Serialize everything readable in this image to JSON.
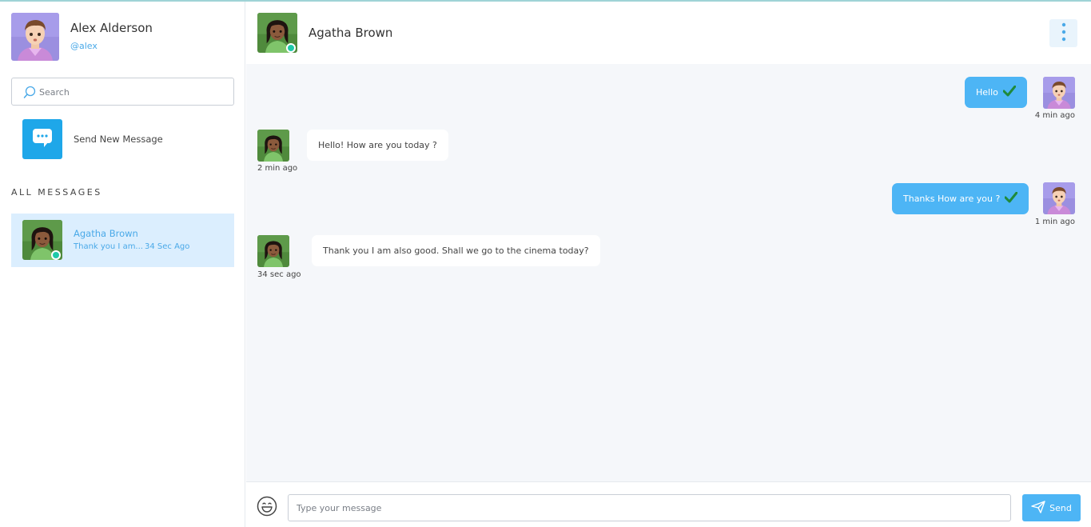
{
  "profile": {
    "name": "Alex Alderson",
    "handle": "@alex"
  },
  "search": {
    "placeholder": "Search"
  },
  "new_message": {
    "label": "Send New Message"
  },
  "all_messages": {
    "title": "ALL MESSAGES"
  },
  "conversations": [
    {
      "name": "Agatha Brown",
      "preview": "Thank you I am...",
      "time": "34 Sec Ago",
      "online": true
    }
  ],
  "chat": {
    "title": "Agatha Brown",
    "messages": [
      {
        "direction": "out",
        "text": "Hello",
        "time": "4 min ago",
        "read": true
      },
      {
        "direction": "in",
        "text": "Hello! How are you today ?",
        "time": "2 min ago"
      },
      {
        "direction": "out",
        "text": "Thanks How are you ?",
        "time": "1 min ago",
        "read": true
      },
      {
        "direction": "in",
        "text": "Thank you I am also good. Shall we go to the cinema today?",
        "time": "34 sec ago"
      }
    ]
  },
  "composer": {
    "placeholder": "Type your message",
    "send_label": "Send"
  },
  "colors": {
    "accent": "#4db5f5",
    "online": "#1ec9a8",
    "selected_bg": "#dbeefe",
    "chat_bg": "#f5f7fa"
  },
  "icons": [
    "search-icon",
    "chat-bubble-icon",
    "online-dot",
    "kebab-menu-icon",
    "check-icon",
    "emoji-icon",
    "send-icon"
  ]
}
